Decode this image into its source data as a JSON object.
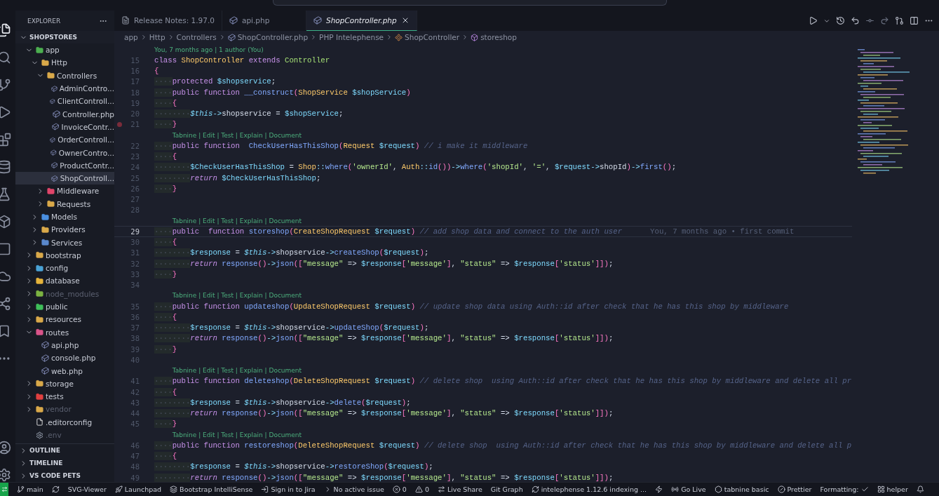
{
  "sidebar": {
    "title": "EXPLORER",
    "root": {
      "label": "SHOPSTORES",
      "expanded": true
    },
    "tree": [
      {
        "label": "app",
        "kind": "folder",
        "color": "#4caf50",
        "expanded": true,
        "selected": false,
        "dimmed": false,
        "children": [
          {
            "label": "Http",
            "kind": "folder",
            "color": "#d9a94a",
            "expanded": true,
            "selected": false,
            "dimmed": false,
            "children": [
              {
                "label": "Controllers",
                "kind": "folder",
                "color": "#d9a94a",
                "expanded": true,
                "selected": false,
                "dimmed": false,
                "children": [
                  {
                    "label": "AdminContro...",
                    "kind": "php",
                    "selected": false,
                    "dimmed": false
                  },
                  {
                    "label": "ClientControll...",
                    "kind": "php",
                    "selected": false,
                    "dimmed": false
                  },
                  {
                    "label": "Controller.php",
                    "kind": "php",
                    "selected": false,
                    "dimmed": false
                  },
                  {
                    "label": "InvoiceContr...",
                    "kind": "php",
                    "selected": false,
                    "dimmed": false
                  },
                  {
                    "label": "OrderControll...",
                    "kind": "php",
                    "selected": false,
                    "dimmed": false
                  },
                  {
                    "label": "OwnerContro...",
                    "kind": "php",
                    "selected": false,
                    "dimmed": false
                  },
                  {
                    "label": "ProductContr...",
                    "kind": "php",
                    "selected": false,
                    "dimmed": false
                  },
                  {
                    "label": "ShopControll...",
                    "kind": "php",
                    "selected": true,
                    "dimmed": false
                  }
                ]
              },
              {
                "label": "Middleware",
                "kind": "folder",
                "color": "#e0456a",
                "expanded": false,
                "selected": false,
                "dimmed": false
              },
              {
                "label": "Requests",
                "kind": "folder",
                "color": "#d9a94a",
                "expanded": false,
                "selected": false,
                "dimmed": false
              }
            ]
          },
          {
            "label": "Models",
            "kind": "folder",
            "color": "#4a8fe0",
            "expanded": false,
            "selected": false,
            "dimmed": false
          },
          {
            "label": "Providers",
            "kind": "folder",
            "color": "#d9a94a",
            "expanded": false,
            "selected": false,
            "dimmed": false
          },
          {
            "label": "Services",
            "kind": "folder",
            "color": "#5a88cc",
            "expanded": false,
            "selected": false,
            "dimmed": false
          }
        ]
      },
      {
        "label": "bootstrap",
        "kind": "folder",
        "color": "#d9a94a",
        "expanded": false,
        "selected": false,
        "dimmed": false
      },
      {
        "label": "config",
        "kind": "folder",
        "color": "#4aa3d6",
        "expanded": false,
        "selected": false,
        "dimmed": false
      },
      {
        "label": "database",
        "kind": "folder",
        "color": "#e6b43c",
        "expanded": false,
        "selected": false,
        "dimmed": false
      },
      {
        "label": "node_modules",
        "kind": "folder",
        "color": "#7cb342",
        "expanded": false,
        "selected": false,
        "dimmed": true
      },
      {
        "label": "public",
        "kind": "folder",
        "color": "#3fbf5a",
        "expanded": false,
        "selected": false,
        "dimmed": false
      },
      {
        "label": "resources",
        "kind": "folder",
        "color": "#d9a94a",
        "expanded": false,
        "selected": false,
        "dimmed": false
      },
      {
        "label": "routes",
        "kind": "folder",
        "color": "#d9548a",
        "expanded": true,
        "selected": false,
        "dimmed": false,
        "children": [
          {
            "label": "api.php",
            "kind": "php",
            "selected": false,
            "dimmed": false
          },
          {
            "label": "console.php",
            "kind": "php",
            "selected": false,
            "dimmed": false
          },
          {
            "label": "web.php",
            "kind": "php",
            "selected": false,
            "dimmed": false
          }
        ]
      },
      {
        "label": "storage",
        "kind": "folder",
        "color": "#d9a94a",
        "expanded": false,
        "selected": false,
        "dimmed": false
      },
      {
        "label": "tests",
        "kind": "folder",
        "color": "#e04040",
        "expanded": false,
        "selected": false,
        "dimmed": false
      },
      {
        "label": "vendor",
        "kind": "folder",
        "color": "#d9a94a",
        "expanded": false,
        "selected": false,
        "dimmed": true
      },
      {
        "label": ".editorconfig",
        "kind": "config",
        "selected": false,
        "dimmed": false
      },
      {
        "label": ".env",
        "kind": "env",
        "selected": false,
        "dimmed": true
      }
    ],
    "sections": [
      "OUTLINE",
      "TIMELINE",
      "VS CODE PETS"
    ]
  },
  "tabs": [
    {
      "label": "Release Notes: 1.97.0",
      "kind": "notes",
      "selected": false
    },
    {
      "label": "api.php",
      "kind": "php",
      "selected": false
    },
    {
      "label": "ShopController.php",
      "kind": "php",
      "selected": true
    }
  ],
  "breadcrumbs": [
    {
      "label": "app",
      "kind": "plain"
    },
    {
      "label": "Http",
      "kind": "plain"
    },
    {
      "label": "Controllers",
      "kind": "plain"
    },
    {
      "label": "ShopController.php",
      "kind": "php"
    },
    {
      "label": "PHP Intelephense",
      "kind": "plain"
    },
    {
      "label": "ShopController",
      "kind": "class"
    },
    {
      "label": "storeshop",
      "kind": "method"
    }
  ],
  "editor": {
    "rows": [
      {
        "kind": "lens",
        "text": "You, 7 months ago | 1 author (You)"
      },
      {
        "kind": "code",
        "n": "15",
        "current": false,
        "breakpoint": false,
        "tokens": [
          {
            "kind": "kw",
            "text": "class "
          },
          {
            "kind": "ty",
            "text": "ShopController "
          },
          {
            "kind": "kw",
            "text": "extends "
          },
          {
            "kind": "ty2",
            "text": "Controller"
          }
        ]
      },
      {
        "kind": "code",
        "n": "16",
        "current": false,
        "breakpoint": false,
        "tokens": [
          {
            "kind": "br",
            "text": "{"
          }
        ]
      },
      {
        "kind": "code",
        "n": "17",
        "current": false,
        "breakpoint": false,
        "tokens": [
          {
            "kind": "ws",
            "text": "····"
          },
          {
            "kind": "kw",
            "text": "protected "
          },
          {
            "kind": "var",
            "text": "$shopservice"
          },
          {
            "kind": "p",
            "text": ";"
          }
        ]
      },
      {
        "kind": "code",
        "n": "18",
        "current": false,
        "breakpoint": false,
        "tokens": [
          {
            "kind": "ws",
            "text": "····"
          },
          {
            "kind": "kw",
            "text": "public "
          },
          {
            "kind": "kw",
            "text": "function "
          },
          {
            "kind": "fn",
            "text": "__construct"
          },
          {
            "kind": "br",
            "text": "("
          },
          {
            "kind": "ty",
            "text": "ShopService "
          },
          {
            "kind": "var",
            "text": "$shopService"
          },
          {
            "kind": "br",
            "text": ")"
          }
        ]
      },
      {
        "kind": "code",
        "n": "19",
        "current": false,
        "breakpoint": false,
        "tokens": [
          {
            "kind": "ws",
            "text": "····"
          },
          {
            "kind": "br",
            "text": "{"
          }
        ]
      },
      {
        "kind": "code",
        "n": "20",
        "current": false,
        "breakpoint": false,
        "tokens": [
          {
            "kind": "ws",
            "text": "········"
          },
          {
            "kind": "this",
            "text": "$this"
          },
          {
            "kind": "op",
            "text": "->"
          },
          {
            "kind": "p",
            "text": "shopservice = "
          },
          {
            "kind": "var",
            "text": "$shopService"
          },
          {
            "kind": "p",
            "text": ";"
          }
        ]
      },
      {
        "kind": "code",
        "n": "21",
        "current": false,
        "breakpoint": true,
        "tokens": [
          {
            "kind": "ws",
            "text": "····"
          },
          {
            "kind": "br",
            "text": "}"
          }
        ]
      },
      {
        "kind": "lens",
        "text": "Tabnine | Edit | Test | Explain | Document"
      },
      {
        "kind": "code",
        "n": "22",
        "current": false,
        "breakpoint": false,
        "tokens": [
          {
            "kind": "ws",
            "text": "····"
          },
          {
            "kind": "kw",
            "text": "public "
          },
          {
            "kind": "kw",
            "text": "function  "
          },
          {
            "kind": "fn",
            "text": "CheckUserHasThisShop"
          },
          {
            "kind": "br",
            "text": "("
          },
          {
            "kind": "ty",
            "text": "Request "
          },
          {
            "kind": "var",
            "text": "$request"
          },
          {
            "kind": "br",
            "text": ")"
          },
          {
            "kind": "cmt",
            "text": " // i make it middleware"
          }
        ]
      },
      {
        "kind": "code",
        "n": "23",
        "current": false,
        "breakpoint": false,
        "tokens": [
          {
            "kind": "ws",
            "text": "····"
          },
          {
            "kind": "br",
            "text": "{"
          }
        ]
      },
      {
        "kind": "code",
        "n": "24",
        "current": false,
        "breakpoint": false,
        "tokens": [
          {
            "kind": "ws",
            "text": "········"
          },
          {
            "kind": "var",
            "text": "$CheckUserHasThisShop"
          },
          {
            "kind": "p",
            "text": " = "
          },
          {
            "kind": "ty",
            "text": "Shop"
          },
          {
            "kind": "op",
            "text": "::"
          },
          {
            "kind": "fn",
            "text": "where"
          },
          {
            "kind": "br",
            "text": "("
          },
          {
            "kind": "str",
            "text": "'ownerId'"
          },
          {
            "kind": "p",
            "text": ", "
          },
          {
            "kind": "ty",
            "text": "Auth"
          },
          {
            "kind": "op",
            "text": "::"
          },
          {
            "kind": "fn",
            "text": "id"
          },
          {
            "kind": "br",
            "text": "())"
          },
          {
            "kind": "op",
            "text": "->"
          },
          {
            "kind": "fn",
            "text": "where"
          },
          {
            "kind": "br",
            "text": "("
          },
          {
            "kind": "str",
            "text": "'shopId'"
          },
          {
            "kind": "p",
            "text": ", "
          },
          {
            "kind": "str",
            "text": "'='"
          },
          {
            "kind": "p",
            "text": ", "
          },
          {
            "kind": "var",
            "text": "$request"
          },
          {
            "kind": "op",
            "text": "->"
          },
          {
            "kind": "p",
            "text": "shopId"
          },
          {
            "kind": "br",
            "text": ")"
          },
          {
            "kind": "op",
            "text": "->"
          },
          {
            "kind": "fn",
            "text": "first"
          },
          {
            "kind": "br",
            "text": "()"
          },
          {
            "kind": "p",
            "text": ";"
          }
        ]
      },
      {
        "kind": "code",
        "n": "25",
        "current": false,
        "breakpoint": false,
        "tokens": [
          {
            "kind": "ws",
            "text": "········"
          },
          {
            "kind": "ret",
            "text": "return "
          },
          {
            "kind": "var",
            "text": "$CheckUserHasThisShop"
          },
          {
            "kind": "p",
            "text": ";"
          }
        ]
      },
      {
        "kind": "code",
        "n": "26",
        "current": false,
        "breakpoint": false,
        "tokens": [
          {
            "kind": "ws",
            "text": "····"
          },
          {
            "kind": "br",
            "text": "}"
          }
        ]
      },
      {
        "kind": "code",
        "n": "27",
        "current": false,
        "breakpoint": false
      },
      {
        "kind": "code",
        "n": "28",
        "current": false,
        "breakpoint": false
      },
      {
        "kind": "lens",
        "text": "Tabnine | Edit | Test | Explain | Document"
      },
      {
        "kind": "code",
        "n": "29",
        "current": true,
        "breakpoint": false,
        "blame": "You, 7 months ago • first commit",
        "tokens": [
          {
            "kind": "ws",
            "text": "····"
          },
          {
            "kind": "kw",
            "text": "public  "
          },
          {
            "kind": "kw",
            "text": "function "
          },
          {
            "kind": "fn",
            "text": "storeshop"
          },
          {
            "kind": "br",
            "text": "("
          },
          {
            "kind": "ty",
            "text": "CreateShopRequest "
          },
          {
            "kind": "var",
            "text": "$request"
          },
          {
            "kind": "br",
            "text": ")"
          },
          {
            "kind": "cmt",
            "text": " // add shop data and connect to the auth user"
          }
        ]
      },
      {
        "kind": "code",
        "n": "30",
        "current": false,
        "breakpoint": false,
        "tokens": [
          {
            "kind": "ws",
            "text": "····"
          },
          {
            "kind": "br",
            "text": "{"
          }
        ]
      },
      {
        "kind": "code",
        "n": "31",
        "current": false,
        "breakpoint": false,
        "tokens": [
          {
            "kind": "ws",
            "text": "········"
          },
          {
            "kind": "var",
            "text": "$response"
          },
          {
            "kind": "p",
            "text": " = "
          },
          {
            "kind": "this",
            "text": "$this"
          },
          {
            "kind": "op",
            "text": "->"
          },
          {
            "kind": "p",
            "text": "shopservice"
          },
          {
            "kind": "op",
            "text": "->"
          },
          {
            "kind": "fn",
            "text": "createShop"
          },
          {
            "kind": "br",
            "text": "("
          },
          {
            "kind": "var",
            "text": "$request"
          },
          {
            "kind": "br",
            "text": ")"
          },
          {
            "kind": "p",
            "text": ";"
          }
        ]
      },
      {
        "kind": "code",
        "n": "32",
        "current": false,
        "breakpoint": false,
        "tokens": [
          {
            "kind": "ws",
            "text": "········"
          },
          {
            "kind": "ret",
            "text": "return "
          },
          {
            "kind": "fn",
            "text": "response"
          },
          {
            "kind": "br",
            "text": "()"
          },
          {
            "kind": "op",
            "text": "->"
          },
          {
            "kind": "fn",
            "text": "json"
          },
          {
            "kind": "br",
            "text": "(["
          },
          {
            "kind": "str",
            "text": "\"message\""
          },
          {
            "kind": "p",
            "text": " => "
          },
          {
            "kind": "var",
            "text": "$response"
          },
          {
            "kind": "br",
            "text": "["
          },
          {
            "kind": "str",
            "text": "'message'"
          },
          {
            "kind": "br",
            "text": "]"
          },
          {
            "kind": "p",
            "text": ", "
          },
          {
            "kind": "str",
            "text": "\"status\""
          },
          {
            "kind": "p",
            "text": " => "
          },
          {
            "kind": "var",
            "text": "$response"
          },
          {
            "kind": "br",
            "text": "["
          },
          {
            "kind": "str",
            "text": "'status'"
          },
          {
            "kind": "br",
            "text": "]])"
          },
          {
            "kind": "p",
            "text": ";"
          }
        ]
      },
      {
        "kind": "code",
        "n": "33",
        "current": false,
        "breakpoint": false,
        "tokens": [
          {
            "kind": "ws",
            "text": "····"
          },
          {
            "kind": "br",
            "text": "}"
          }
        ]
      },
      {
        "kind": "code",
        "n": "34",
        "current": false,
        "breakpoint": false
      },
      {
        "kind": "lens",
        "text": "Tabnine | Edit | Test | Explain | Document"
      },
      {
        "kind": "code",
        "n": "35",
        "current": false,
        "breakpoint": false,
        "tokens": [
          {
            "kind": "ws",
            "text": "····"
          },
          {
            "kind": "kw",
            "text": "public "
          },
          {
            "kind": "kw",
            "text": "function "
          },
          {
            "kind": "fn",
            "text": "updateshop"
          },
          {
            "kind": "br",
            "text": "("
          },
          {
            "kind": "ty",
            "text": "UpdateShopRequest "
          },
          {
            "kind": "var",
            "text": "$request"
          },
          {
            "kind": "br",
            "text": ")"
          },
          {
            "kind": "cmt",
            "text": " // update shop data using Auth::id after check that he has this shop by middleware"
          }
        ]
      },
      {
        "kind": "code",
        "n": "36",
        "current": false,
        "breakpoint": false,
        "tokens": [
          {
            "kind": "ws",
            "text": "····"
          },
          {
            "kind": "br",
            "text": "{"
          }
        ]
      },
      {
        "kind": "code",
        "n": "37",
        "current": false,
        "breakpoint": false,
        "tokens": [
          {
            "kind": "ws",
            "text": "········"
          },
          {
            "kind": "var",
            "text": "$response"
          },
          {
            "kind": "p",
            "text": " = "
          },
          {
            "kind": "this",
            "text": "$this"
          },
          {
            "kind": "op",
            "text": "->"
          },
          {
            "kind": "p",
            "text": "shopservice"
          },
          {
            "kind": "op",
            "text": "->"
          },
          {
            "kind": "fn",
            "text": "updateShop"
          },
          {
            "kind": "br",
            "text": "("
          },
          {
            "kind": "var",
            "text": "$request"
          },
          {
            "kind": "br",
            "text": ")"
          },
          {
            "kind": "p",
            "text": ";"
          }
        ]
      },
      {
        "kind": "code",
        "n": "38",
        "current": false,
        "breakpoint": false,
        "tokens": [
          {
            "kind": "ws",
            "text": "········"
          },
          {
            "kind": "ret",
            "text": "return "
          },
          {
            "kind": "fn",
            "text": "response"
          },
          {
            "kind": "br",
            "text": "()"
          },
          {
            "kind": "op",
            "text": "->"
          },
          {
            "kind": "fn",
            "text": "json"
          },
          {
            "kind": "br",
            "text": "(["
          },
          {
            "kind": "str",
            "text": "\"message\""
          },
          {
            "kind": "p",
            "text": " => "
          },
          {
            "kind": "var",
            "text": "$response"
          },
          {
            "kind": "br",
            "text": "["
          },
          {
            "kind": "str",
            "text": "'message'"
          },
          {
            "kind": "br",
            "text": "]"
          },
          {
            "kind": "p",
            "text": ", "
          },
          {
            "kind": "str",
            "text": "\"status\""
          },
          {
            "kind": "p",
            "text": " => "
          },
          {
            "kind": "var",
            "text": "$response"
          },
          {
            "kind": "br",
            "text": "["
          },
          {
            "kind": "str",
            "text": "'status'"
          },
          {
            "kind": "br",
            "text": "]])"
          },
          {
            "kind": "p",
            "text": ";"
          }
        ]
      },
      {
        "kind": "code",
        "n": "39",
        "current": false,
        "breakpoint": false,
        "tokens": [
          {
            "kind": "ws",
            "text": "····"
          },
          {
            "kind": "br",
            "text": "}"
          }
        ]
      },
      {
        "kind": "code",
        "n": "40",
        "current": false,
        "breakpoint": false
      },
      {
        "kind": "lens",
        "text": "Tabnine | Edit | Test | Explain | Document"
      },
      {
        "kind": "code",
        "n": "41",
        "current": false,
        "breakpoint": false,
        "tokens": [
          {
            "kind": "ws",
            "text": "····"
          },
          {
            "kind": "kw",
            "text": "public "
          },
          {
            "kind": "kw",
            "text": "function "
          },
          {
            "kind": "fn",
            "text": "deleteshop"
          },
          {
            "kind": "br",
            "text": "("
          },
          {
            "kind": "ty",
            "text": "DeleteShopRequest "
          },
          {
            "kind": "var",
            "text": "$request"
          },
          {
            "kind": "br",
            "text": ")"
          },
          {
            "kind": "cmt",
            "text": " // delete shop  using Auth::id after check that he has this shop by middleware and delete all pr"
          }
        ]
      },
      {
        "kind": "code",
        "n": "42",
        "current": false,
        "breakpoint": false,
        "tokens": [
          {
            "kind": "ws",
            "text": "····"
          },
          {
            "kind": "br",
            "text": "{"
          }
        ]
      },
      {
        "kind": "code",
        "n": "43",
        "current": false,
        "breakpoint": false,
        "tokens": [
          {
            "kind": "ws",
            "text": "········"
          },
          {
            "kind": "var",
            "text": "$response"
          },
          {
            "kind": "p",
            "text": " = "
          },
          {
            "kind": "this",
            "text": "$this"
          },
          {
            "kind": "op",
            "text": "->"
          },
          {
            "kind": "p",
            "text": "shopservice"
          },
          {
            "kind": "op",
            "text": "->"
          },
          {
            "kind": "fn",
            "text": "delete"
          },
          {
            "kind": "br",
            "text": "("
          },
          {
            "kind": "var",
            "text": "$request"
          },
          {
            "kind": "br",
            "text": ")"
          },
          {
            "kind": "p",
            "text": ";"
          }
        ]
      },
      {
        "kind": "code",
        "n": "44",
        "current": false,
        "breakpoint": false,
        "tokens": [
          {
            "kind": "ws",
            "text": "········"
          },
          {
            "kind": "ret",
            "text": "return "
          },
          {
            "kind": "fn",
            "text": "response"
          },
          {
            "kind": "br",
            "text": "()"
          },
          {
            "kind": "op",
            "text": "->"
          },
          {
            "kind": "fn",
            "text": "json"
          },
          {
            "kind": "br",
            "text": "(["
          },
          {
            "kind": "str",
            "text": "\"message\""
          },
          {
            "kind": "p",
            "text": " => "
          },
          {
            "kind": "var",
            "text": "$response"
          },
          {
            "kind": "br",
            "text": "["
          },
          {
            "kind": "str",
            "text": "'message'"
          },
          {
            "kind": "br",
            "text": "]"
          },
          {
            "kind": "p",
            "text": ", "
          },
          {
            "kind": "str",
            "text": "\"status\""
          },
          {
            "kind": "p",
            "text": " => "
          },
          {
            "kind": "var",
            "text": "$response"
          },
          {
            "kind": "br",
            "text": "["
          },
          {
            "kind": "str",
            "text": "'status'"
          },
          {
            "kind": "br",
            "text": "]])"
          },
          {
            "kind": "p",
            "text": ";"
          }
        ]
      },
      {
        "kind": "code",
        "n": "45",
        "current": false,
        "breakpoint": false,
        "tokens": [
          {
            "kind": "ws",
            "text": "····"
          },
          {
            "kind": "br",
            "text": "}"
          }
        ]
      },
      {
        "kind": "lens",
        "text": "Tabnine | Edit | Test | Explain | Document"
      },
      {
        "kind": "code",
        "n": "46",
        "current": false,
        "breakpoint": false,
        "tokens": [
          {
            "kind": "ws",
            "text": "····"
          },
          {
            "kind": "kw",
            "text": "public "
          },
          {
            "kind": "kw",
            "text": "function "
          },
          {
            "kind": "fn",
            "text": "restoreshop"
          },
          {
            "kind": "br",
            "text": "("
          },
          {
            "kind": "ty",
            "text": "DeleteShopRequest "
          },
          {
            "kind": "var",
            "text": "$request"
          },
          {
            "kind": "br",
            "text": ")"
          },
          {
            "kind": "cmt",
            "text": " // delete shop  using Auth::id after check that he has this shop by middleware and delete all p"
          }
        ]
      },
      {
        "kind": "code",
        "n": "47",
        "current": false,
        "breakpoint": false,
        "tokens": [
          {
            "kind": "ws",
            "text": "····"
          },
          {
            "kind": "br",
            "text": "{"
          }
        ]
      },
      {
        "kind": "code",
        "n": "48",
        "current": false,
        "breakpoint": false,
        "tokens": [
          {
            "kind": "ws",
            "text": "········"
          },
          {
            "kind": "var",
            "text": "$response"
          },
          {
            "kind": "p",
            "text": " = "
          },
          {
            "kind": "this",
            "text": "$this"
          },
          {
            "kind": "op",
            "text": "->"
          },
          {
            "kind": "p",
            "text": "shopservice"
          },
          {
            "kind": "op",
            "text": "->"
          },
          {
            "kind": "fn",
            "text": "restoreShop"
          },
          {
            "kind": "br",
            "text": "("
          },
          {
            "kind": "var",
            "text": "$request"
          },
          {
            "kind": "br",
            "text": ")"
          },
          {
            "kind": "p",
            "text": ";"
          }
        ]
      },
      {
        "kind": "code",
        "n": "49",
        "current": false,
        "breakpoint": false,
        "tokens": [
          {
            "kind": "ws",
            "text": "········"
          },
          {
            "kind": "ret",
            "text": "return "
          },
          {
            "kind": "fn",
            "text": "response"
          },
          {
            "kind": "br",
            "text": "()"
          },
          {
            "kind": "op",
            "text": "->"
          },
          {
            "kind": "fn",
            "text": "json"
          },
          {
            "kind": "br",
            "text": "(["
          },
          {
            "kind": "str",
            "text": "\"message\""
          },
          {
            "kind": "p",
            "text": " => "
          },
          {
            "kind": "var",
            "text": "$response"
          },
          {
            "kind": "br",
            "text": "["
          },
          {
            "kind": "str",
            "text": "'message'"
          },
          {
            "kind": "br",
            "text": "]"
          },
          {
            "kind": "p",
            "text": ", "
          },
          {
            "kind": "str",
            "text": "\"status\""
          },
          {
            "kind": "p",
            "text": " => "
          },
          {
            "kind": "var",
            "text": "$response"
          },
          {
            "kind": "br",
            "text": "["
          },
          {
            "kind": "str",
            "text": "'status'"
          },
          {
            "kind": "br",
            "text": "]])"
          },
          {
            "kind": "p",
            "text": ";"
          }
        ]
      }
    ]
  },
  "status_bar": [
    {
      "kind": "branch",
      "text": "main"
    },
    {
      "kind": "sync"
    },
    {
      "kind": "plain",
      "text": "SVG-Viewer"
    },
    {
      "kind": "rocket",
      "text": "Launchpad"
    },
    {
      "kind": "layers",
      "text": "Bootstrap IntelliSense"
    },
    {
      "kind": "login",
      "text": "Sign in to Jira"
    },
    {
      "kind": "chevron",
      "text": "No active issue"
    },
    {
      "kind": "error",
      "text": "0"
    },
    {
      "kind": "warning",
      "text": "0"
    },
    {
      "kind": "share",
      "text": "Live Share"
    },
    {
      "kind": "plain",
      "text": "Git Graph"
    },
    {
      "kind": "sync",
      "text": "intelephense 1.12.6 indexing ..."
    },
    {
      "kind": "zap"
    },
    {
      "kind": "radio",
      "text": "Go Live"
    },
    {
      "kind": "hexagon",
      "text": "tabnine basic"
    },
    {
      "kind": "slash",
      "text": "Prettier"
    },
    {
      "kind": "check-after",
      "text": "Formatting:"
    },
    {
      "kind": "grid",
      "text": "helper"
    },
    {
      "kind": "bell"
    }
  ]
}
